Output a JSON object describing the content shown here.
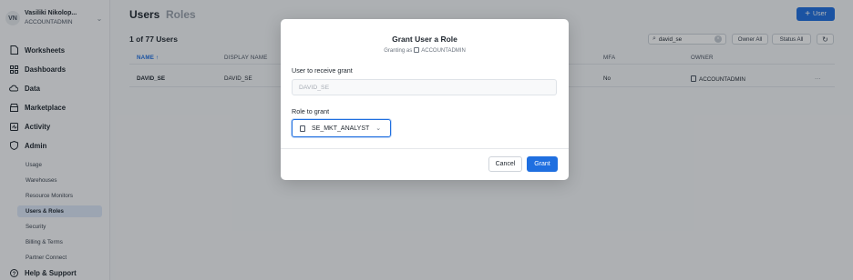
{
  "account": {
    "initials": "VN",
    "name": "Vasiliki Nikolop...",
    "role": "ACCOUNTADMIN"
  },
  "nav": {
    "worksheets": "Worksheets",
    "dashboards": "Dashboards",
    "data": "Data",
    "marketplace": "Marketplace",
    "activity": "Activity",
    "admin": "Admin",
    "help": "Help & Support"
  },
  "admin_sub": {
    "usage": "Usage",
    "warehouses": "Warehouses",
    "resource_monitors": "Resource Monitors",
    "users_roles": "Users & Roles",
    "security": "Security",
    "billing": "Billing & Terms",
    "partner": "Partner Connect"
  },
  "tabs": {
    "users": "Users",
    "roles": "Roles"
  },
  "add_user_label": "User",
  "count_text": "1 of 77 Users",
  "search": {
    "value": "david_se"
  },
  "filters": {
    "owner": "Owner All",
    "status": "Status All"
  },
  "table": {
    "headers": {
      "name": "NAME ↑",
      "display_name": "DISPLAY NAME",
      "mfa": "MFA",
      "owner": "OWNER"
    },
    "rows": [
      {
        "name": "DAVID_SE",
        "display_name": "DAVID_SE",
        "mfa": "No",
        "owner": "ACCOUNTADMIN",
        "more": "···"
      }
    ]
  },
  "modal": {
    "title": "Grant User a Role",
    "subtitle_prefix": "Granting as",
    "subtitle_role": "ACCOUNTADMIN",
    "user_label": "User to receive grant",
    "user_value": "DAVID_SE",
    "role_label": "Role to grant",
    "role_value": "SE_MKT_ANALYST",
    "cancel": "Cancel",
    "grant": "Grant"
  },
  "colors": {
    "accent": "#1f6fe0",
    "active_nav_bg": "#dde8f8"
  }
}
